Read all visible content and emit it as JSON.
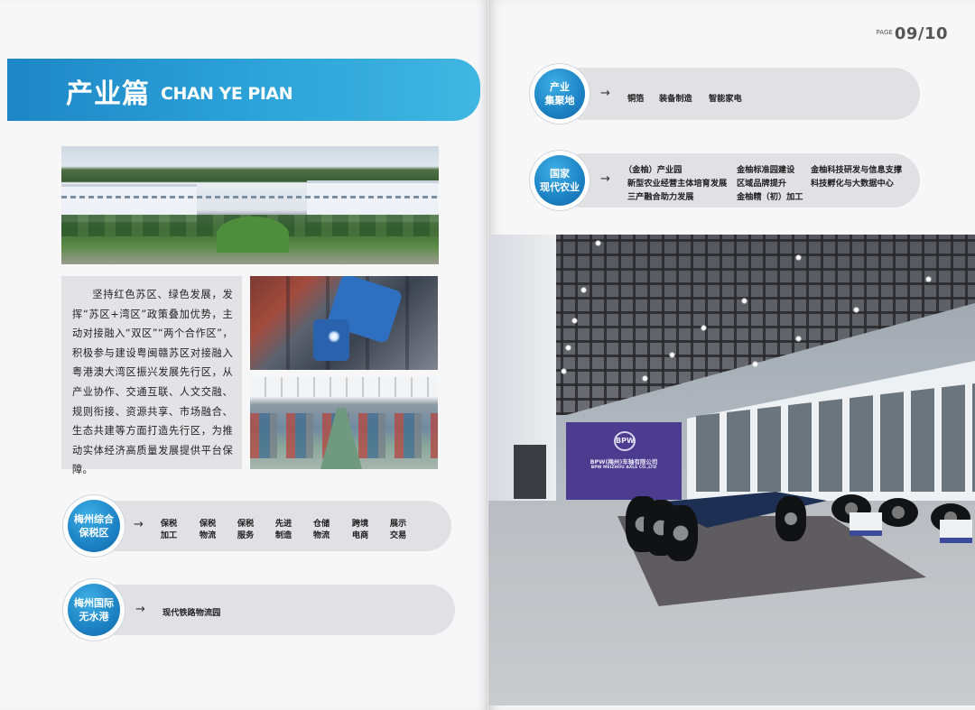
{
  "left_page": {
    "banner": {
      "title": "产业篇",
      "subtitle": "CHAN YE PIAN"
    },
    "paragraph": "坚持红色苏区、绿色发展，发挥“苏区+湾区”政策叠加优势，主动对接融入“双区”“两个合作区”，积极参与建设粤闽赣苏区对接融入粤港澳大湾区振兴发展先行区，从产业协作、交通互联、人文交融、规则衔接、资源共享、市场融合、生态共建等方面打造先行区，为推动实体经济高质量发展提供平台保障。",
    "bonded_zone": {
      "badge": [
        "梅州综合",
        "保税区"
      ],
      "arrow": "→",
      "items": [
        [
          "保税",
          "加工"
        ],
        [
          "保税",
          "物流"
        ],
        [
          "保税",
          "服务"
        ],
        [
          "先进",
          "制造"
        ],
        [
          "仓储",
          "物流"
        ],
        [
          "跨境",
          "电商"
        ],
        [
          "展示",
          "交易"
        ]
      ]
    },
    "dry_port": {
      "badge": [
        "梅州国际",
        "无水港"
      ],
      "arrow": "→",
      "text": "现代铁路物流园"
    }
  },
  "right_page": {
    "page_label": "PAGE",
    "page_number": "09/10",
    "cluster": {
      "badge": [
        "产业",
        "集聚地"
      ],
      "arrow": "→",
      "items": [
        "铜箔",
        "装备制造",
        "智能家电"
      ]
    },
    "agriculture": {
      "badge": [
        "国家",
        "现代农业"
      ],
      "arrow": "→",
      "col1": [
        "（金柚）产业园",
        "新型农业经营主体培育发展",
        "三产融合助力发展"
      ],
      "col2": [
        "金柚标准园建设",
        "区域品牌提升",
        "金柚精（初）加工"
      ],
      "col3": [
        "金柚科技研发与信息支撑",
        "科技孵化与大数据中心"
      ]
    },
    "showroom": {
      "logo_mark": "BPW",
      "logo_name": "BPW(梅州)车轴有限公司",
      "logo_name_en": "BPW MEIZHOU AXLE CO.,LTD"
    }
  }
}
